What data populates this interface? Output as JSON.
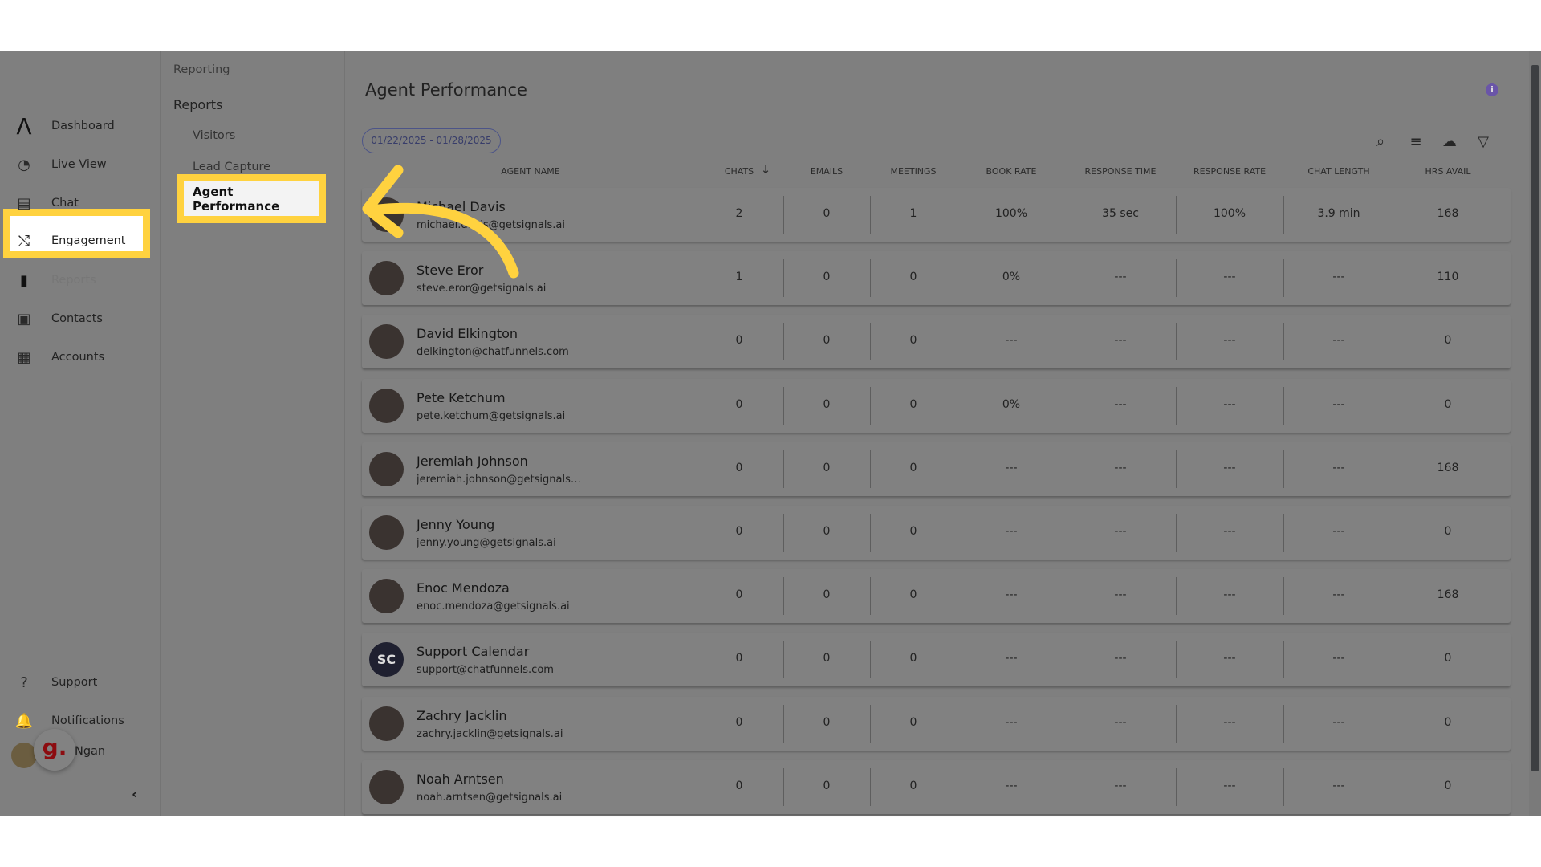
{
  "sidebar": {
    "items": [
      {
        "label": "Dashboard",
        "icon": "logo-icon"
      },
      {
        "label": "Live View",
        "icon": "live-view-icon"
      },
      {
        "label": "Chat",
        "icon": "chat-icon"
      },
      {
        "label": "Engagement",
        "icon": "engagement-icon"
      },
      {
        "label": "Reports",
        "icon": "bar-chart-icon",
        "active": true
      },
      {
        "label": "Contacts",
        "icon": "contacts-icon"
      },
      {
        "label": "Accounts",
        "icon": "accounts-icon"
      }
    ],
    "bottom": [
      {
        "label": "Support",
        "icon": "help-icon"
      },
      {
        "label": "Notifications",
        "icon": "bell-icon"
      }
    ],
    "user": {
      "name": "Ngan",
      "badge": "g."
    }
  },
  "subnav": {
    "section": "Reporting",
    "group": "Reports",
    "items": [
      "Visitors",
      "Lead Capture",
      "Agent Performance"
    ]
  },
  "main": {
    "title": "Agent Performance",
    "date_range": "01/22/2025 - 01/28/2025",
    "columns": [
      "AGENT NAME",
      "CHATS",
      "EMAILS",
      "MEETINGS",
      "BOOK RATE",
      "RESPONSE TIME",
      "RESPONSE RATE",
      "CHAT LENGTH",
      "HRS AVAIL"
    ],
    "sort_column": "CHATS",
    "sort_dir": "desc",
    "rows": [
      {
        "name": "Michael Davis",
        "email": "michael.davis@getsignals.ai",
        "v": [
          "2",
          "0",
          "1",
          "100%",
          "35 sec",
          "100%",
          "3.9 min",
          "168"
        ]
      },
      {
        "name": "Steve Eror",
        "email": "steve.eror@getsignals.ai",
        "v": [
          "1",
          "0",
          "0",
          "0%",
          "---",
          "---",
          "---",
          "110"
        ]
      },
      {
        "name": "David Elkington",
        "email": "delkington@chatfunnels.com",
        "v": [
          "0",
          "0",
          "0",
          "---",
          "---",
          "---",
          "---",
          "0"
        ]
      },
      {
        "name": "Pete Ketchum",
        "email": "pete.ketchum@getsignals.ai",
        "v": [
          "0",
          "0",
          "0",
          "0%",
          "---",
          "---",
          "---",
          "0"
        ]
      },
      {
        "name": "Jeremiah Johnson",
        "email": "jeremiah.johnson@getsignals.ai",
        "v": [
          "0",
          "0",
          "0",
          "---",
          "---",
          "---",
          "---",
          "168"
        ]
      },
      {
        "name": "Jenny Young",
        "email": "jenny.young@getsignals.ai",
        "v": [
          "0",
          "0",
          "0",
          "---",
          "---",
          "---",
          "---",
          "0"
        ]
      },
      {
        "name": "Enoc Mendoza",
        "email": "enoc.mendoza@getsignals.ai",
        "v": [
          "0",
          "0",
          "0",
          "---",
          "---",
          "---",
          "---",
          "168"
        ]
      },
      {
        "name": "Support Calendar",
        "email": "support@chatfunnels.com",
        "initials": "SC",
        "v": [
          "0",
          "0",
          "0",
          "---",
          "---",
          "---",
          "---",
          "0"
        ]
      },
      {
        "name": "Zachry Jacklin",
        "email": "zachry.jacklin@getsignals.ai",
        "v": [
          "0",
          "0",
          "0",
          "---",
          "---",
          "---",
          "---",
          "0"
        ]
      },
      {
        "name": "Noah Arntsen",
        "email": "noah.arntsen@getsignals.ai",
        "v": [
          "0",
          "0",
          "0",
          "---",
          "---",
          "---",
          "---",
          "0"
        ]
      }
    ]
  },
  "colors": {
    "highlight": "#ffd23f",
    "accent": "#6a55a8"
  }
}
